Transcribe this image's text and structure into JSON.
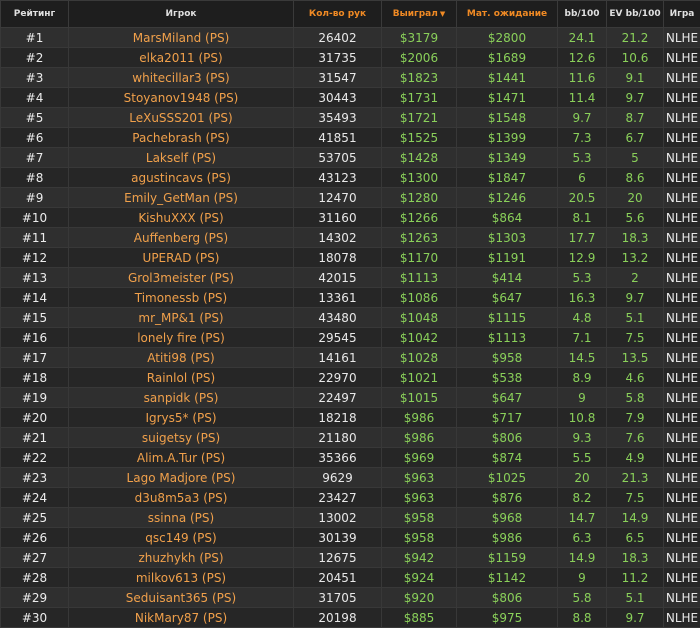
{
  "headers": {
    "rank": "Рейтинг",
    "player": "Игрок",
    "hands": "Кол-во рук",
    "won": "Выиграл",
    "ev": "Мат. ожидание",
    "bb100": "bb/100",
    "evbb100": "EV bb/100",
    "game": "Игра"
  },
  "sort_indicator": "▼",
  "colors": {
    "accent": "#f08a24",
    "player_name": "#f0a04b",
    "positive_value": "#8ad05a",
    "row_odd": "#2f2f2f",
    "row_even": "#262626"
  },
  "rows": [
    {
      "rank": "#1",
      "player": "MarsMiland (PS)",
      "hands": "26402",
      "won": "$3179",
      "ev": "$2800",
      "bb": "24.1",
      "evbb": "21.2",
      "game": "NLHE"
    },
    {
      "rank": "#2",
      "player": "elka2011 (PS)",
      "hands": "31735",
      "won": "$2006",
      "ev": "$1689",
      "bb": "12.6",
      "evbb": "10.6",
      "game": "NLHE"
    },
    {
      "rank": "#3",
      "player": "whitecillar3 (PS)",
      "hands": "31547",
      "won": "$1823",
      "ev": "$1441",
      "bb": "11.6",
      "evbb": "9.1",
      "game": "NLHE"
    },
    {
      "rank": "#4",
      "player": "Stoyanov1948 (PS)",
      "hands": "30443",
      "won": "$1731",
      "ev": "$1471",
      "bb": "11.4",
      "evbb": "9.7",
      "game": "NLHE"
    },
    {
      "rank": "#5",
      "player": "LeXuSSS201 (PS)",
      "hands": "35493",
      "won": "$1721",
      "ev": "$1548",
      "bb": "9.7",
      "evbb": "8.7",
      "game": "NLHE"
    },
    {
      "rank": "#6",
      "player": "Pachebrash (PS)",
      "hands": "41851",
      "won": "$1525",
      "ev": "$1399",
      "bb": "7.3",
      "evbb": "6.7",
      "game": "NLHE"
    },
    {
      "rank": "#7",
      "player": "Lakself (PS)",
      "hands": "53705",
      "won": "$1428",
      "ev": "$1349",
      "bb": "5.3",
      "evbb": "5",
      "game": "NLHE"
    },
    {
      "rank": "#8",
      "player": "agustincavs (PS)",
      "hands": "43123",
      "won": "$1300",
      "ev": "$1847",
      "bb": "6",
      "evbb": "8.6",
      "game": "NLHE"
    },
    {
      "rank": "#9",
      "player": "Emily_GetMan (PS)",
      "hands": "12470",
      "won": "$1280",
      "ev": "$1246",
      "bb": "20.5",
      "evbb": "20",
      "game": "NLHE"
    },
    {
      "rank": "#10",
      "player": "KishuXXX (PS)",
      "hands": "31160",
      "won": "$1266",
      "ev": "$864",
      "bb": "8.1",
      "evbb": "5.6",
      "game": "NLHE"
    },
    {
      "rank": "#11",
      "player": "Auffenberg (PS)",
      "hands": "14302",
      "won": "$1263",
      "ev": "$1303",
      "bb": "17.7",
      "evbb": "18.3",
      "game": "NLHE"
    },
    {
      "rank": "#12",
      "player": "UPERAD (PS)",
      "hands": "18078",
      "won": "$1170",
      "ev": "$1191",
      "bb": "12.9",
      "evbb": "13.2",
      "game": "NLHE"
    },
    {
      "rank": "#13",
      "player": "Grol3meister (PS)",
      "hands": "42015",
      "won": "$1113",
      "ev": "$414",
      "bb": "5.3",
      "evbb": "2",
      "game": "NLHE"
    },
    {
      "rank": "#14",
      "player": "Timonessb (PS)",
      "hands": "13361",
      "won": "$1086",
      "ev": "$647",
      "bb": "16.3",
      "evbb": "9.7",
      "game": "NLHE"
    },
    {
      "rank": "#15",
      "player": "mr_MP&1 (PS)",
      "hands": "43480",
      "won": "$1048",
      "ev": "$1115",
      "bb": "4.8",
      "evbb": "5.1",
      "game": "NLHE"
    },
    {
      "rank": "#16",
      "player": "lonely fire (PS)",
      "hands": "29545",
      "won": "$1042",
      "ev": "$1113",
      "bb": "7.1",
      "evbb": "7.5",
      "game": "NLHE"
    },
    {
      "rank": "#17",
      "player": "Atiti98 (PS)",
      "hands": "14161",
      "won": "$1028",
      "ev": "$958",
      "bb": "14.5",
      "evbb": "13.5",
      "game": "NLHE"
    },
    {
      "rank": "#18",
      "player": "Rainlol (PS)",
      "hands": "22970",
      "won": "$1021",
      "ev": "$538",
      "bb": "8.9",
      "evbb": "4.6",
      "game": "NLHE"
    },
    {
      "rank": "#19",
      "player": "sanpidk (PS)",
      "hands": "22497",
      "won": "$1015",
      "ev": "$647",
      "bb": "9",
      "evbb": "5.8",
      "game": "NLHE"
    },
    {
      "rank": "#20",
      "player": "Igrys5* (PS)",
      "hands": "18218",
      "won": "$986",
      "ev": "$717",
      "bb": "10.8",
      "evbb": "7.9",
      "game": "NLHE"
    },
    {
      "rank": "#21",
      "player": "suigetsy (PS)",
      "hands": "21180",
      "won": "$986",
      "ev": "$806",
      "bb": "9.3",
      "evbb": "7.6",
      "game": "NLHE"
    },
    {
      "rank": "#22",
      "player": "Alim.A.Tur (PS)",
      "hands": "35366",
      "won": "$969",
      "ev": "$874",
      "bb": "5.5",
      "evbb": "4.9",
      "game": "NLHE"
    },
    {
      "rank": "#23",
      "player": "Lago Madjore (PS)",
      "hands": "9629",
      "won": "$963",
      "ev": "$1025",
      "bb": "20",
      "evbb": "21.3",
      "game": "NLHE"
    },
    {
      "rank": "#24",
      "player": "d3u8m5a3 (PS)",
      "hands": "23427",
      "won": "$963",
      "ev": "$876",
      "bb": "8.2",
      "evbb": "7.5",
      "game": "NLHE"
    },
    {
      "rank": "#25",
      "player": "ssinna (PS)",
      "hands": "13002",
      "won": "$958",
      "ev": "$968",
      "bb": "14.7",
      "evbb": "14.9",
      "game": "NLHE"
    },
    {
      "rank": "#26",
      "player": "qsc149 (PS)",
      "hands": "30139",
      "won": "$958",
      "ev": "$986",
      "bb": "6.3",
      "evbb": "6.5",
      "game": "NLHE"
    },
    {
      "rank": "#27",
      "player": "zhuzhykh (PS)",
      "hands": "12675",
      "won": "$942",
      "ev": "$1159",
      "bb": "14.9",
      "evbb": "18.3",
      "game": "NLHE"
    },
    {
      "rank": "#28",
      "player": "milkov613 (PS)",
      "hands": "20451",
      "won": "$924",
      "ev": "$1142",
      "bb": "9",
      "evbb": "11.2",
      "game": "NLHE"
    },
    {
      "rank": "#29",
      "player": "Seduisant365 (PS)",
      "hands": "31705",
      "won": "$920",
      "ev": "$806",
      "bb": "5.8",
      "evbb": "5.1",
      "game": "NLHE"
    },
    {
      "rank": "#30",
      "player": "NikMary87 (PS)",
      "hands": "20198",
      "won": "$885",
      "ev": "$975",
      "bb": "8.8",
      "evbb": "9.7",
      "game": "NLHE"
    }
  ]
}
